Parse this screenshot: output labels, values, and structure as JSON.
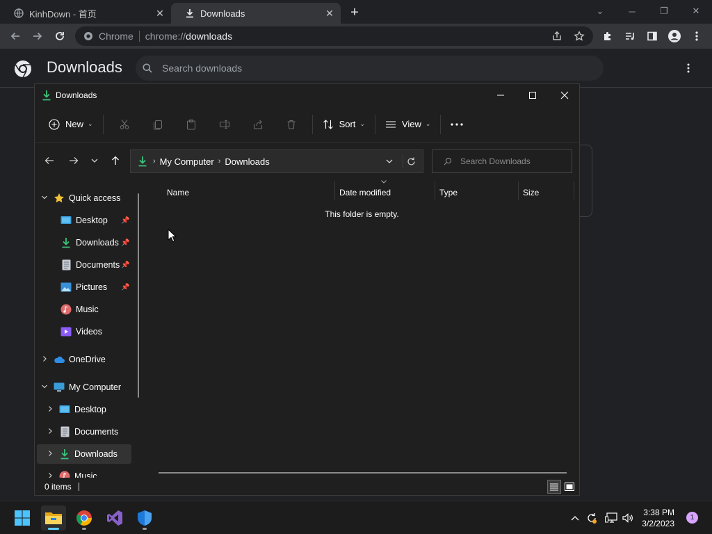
{
  "browser": {
    "tabs": [
      {
        "title": "KinhDown - 首页",
        "icon": "globe-icon"
      },
      {
        "title": "Downloads",
        "icon": "download-icon"
      }
    ],
    "omnibox": {
      "site_label": "Chrome",
      "url_scheme": "chrome://",
      "url_path": "downloads"
    }
  },
  "downloads_page": {
    "title": "Downloads",
    "search_placeholder": "Search downloads"
  },
  "explorer": {
    "window_title": "Downloads",
    "command_bar": {
      "new_label": "New",
      "sort_label": "Sort",
      "view_label": "View"
    },
    "address": {
      "crumbs": [
        "My Computer",
        "Downloads"
      ],
      "search_placeholder": "Search Downloads"
    },
    "nav": {
      "quick_access": "Quick access",
      "items": [
        "Desktop",
        "Downloads",
        "Documents",
        "Pictures",
        "Music",
        "Videos"
      ],
      "onedrive": "OneDrive",
      "my_computer": "My Computer",
      "computer_items": [
        "Desktop",
        "Documents",
        "Downloads",
        "Music"
      ]
    },
    "columns": [
      "Name",
      "Date modified",
      "Type",
      "Size"
    ],
    "empty_message": "This folder is empty.",
    "status": "0 items"
  },
  "taskbar": {
    "time": "3:38 PM",
    "date": "3/2/2023",
    "notification_count": "1"
  },
  "colors": {
    "accent": "#0a84ff",
    "download_green": "#3cc47c",
    "folder_yellow": "#f3c13a"
  }
}
